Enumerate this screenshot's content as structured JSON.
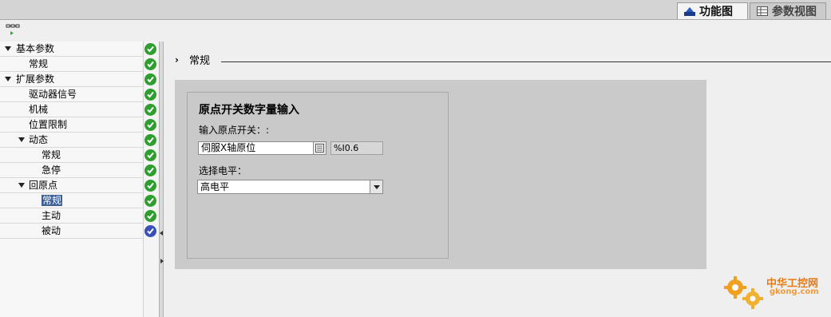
{
  "tabs": [
    {
      "label": "功能图",
      "active": true,
      "icon": "function-view-icon"
    },
    {
      "label": "参数视图",
      "active": false,
      "icon": "parameter-view-icon"
    }
  ],
  "toolbar": {
    "icon": "network-view-icon"
  },
  "tree": {
    "items": [
      {
        "label": "基本参数",
        "level": 0,
        "expandable": true,
        "status": "ok"
      },
      {
        "label": "常规",
        "level": 1,
        "expandable": false,
        "status": "ok"
      },
      {
        "label": "扩展参数",
        "level": 0,
        "expandable": true,
        "status": "ok"
      },
      {
        "label": "驱动器信号",
        "level": 1,
        "expandable": false,
        "status": "ok"
      },
      {
        "label": "机械",
        "level": 1,
        "expandable": false,
        "status": "ok"
      },
      {
        "label": "位置限制",
        "level": 1,
        "expandable": false,
        "status": "ok"
      },
      {
        "label": "动态",
        "level": 1,
        "expandable": true,
        "status": "ok"
      },
      {
        "label": "常规",
        "level": 2,
        "expandable": false,
        "status": "ok"
      },
      {
        "label": "急停",
        "level": 2,
        "expandable": false,
        "status": "ok"
      },
      {
        "label": "回原点",
        "level": 1,
        "expandable": true,
        "status": "ok"
      },
      {
        "label": "常规",
        "level": 2,
        "expandable": false,
        "status": "ok",
        "selected": true
      },
      {
        "label": "主动",
        "level": 2,
        "expandable": false,
        "status": "ok"
      },
      {
        "label": "被动",
        "level": 2,
        "expandable": false,
        "status": "partial"
      }
    ]
  },
  "section": {
    "title": "常规"
  },
  "group": {
    "title": "原点开关数字量输入",
    "home_switch_label": "输入原点开关：:",
    "home_switch_value": "伺服X轴原位",
    "address": "%I0.6",
    "level_label": "选择电平：",
    "level_value": "高电平"
  },
  "watermark": {
    "text_cn": "中华工控网",
    "url": "gkong.com"
  },
  "colors": {
    "accent": "#3c5f95",
    "ok": "#2f9e2f",
    "partial": "#3a50b8",
    "panel": "#cacaca"
  }
}
